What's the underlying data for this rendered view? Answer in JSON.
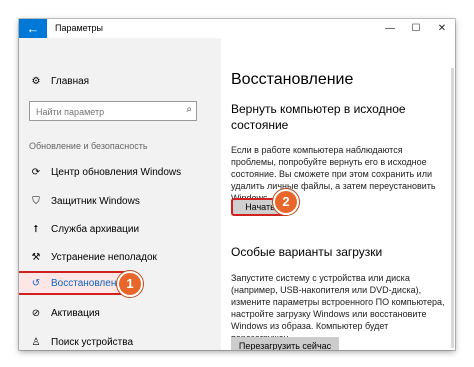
{
  "window": {
    "title": "Параметры",
    "back_icon": "←",
    "controls": {
      "minimize": "—",
      "maximize": "☐",
      "close": "✕"
    }
  },
  "sidebar": {
    "home": {
      "icon": "gear-icon",
      "glyph": "⚙",
      "label": "Главная"
    },
    "search": {
      "placeholder": "Найти параметр",
      "icon": "search-icon",
      "glyph": "⌕"
    },
    "section_title": "Обновление и безопасность",
    "items": [
      {
        "id": "update",
        "icon": "refresh-icon",
        "glyph": "⟳",
        "label": "Центр обновления Windows"
      },
      {
        "id": "defender",
        "icon": "shield-icon",
        "glyph": "⛉",
        "label": "Защитник Windows"
      },
      {
        "id": "backup",
        "icon": "backup-icon",
        "glyph": "⭡",
        "label": "Служба архивации"
      },
      {
        "id": "troubleshoot",
        "icon": "wrench-icon",
        "glyph": "⚒",
        "label": "Устранение неполадок"
      },
      {
        "id": "recovery",
        "icon": "history-icon",
        "glyph": "↺",
        "label": "Восстановление",
        "active": true
      },
      {
        "id": "activation",
        "icon": "check-circle-icon",
        "glyph": "⊘",
        "label": "Активация"
      },
      {
        "id": "find-device",
        "icon": "person-icon",
        "glyph": "♙",
        "label": "Поиск устройства"
      }
    ]
  },
  "main": {
    "page_title": "Восстановление",
    "reset": {
      "heading": "Вернуть компьютер в исходное состояние",
      "description": "Если в работе компьютера наблюдаются проблемы, попробуйте вернуть его в исходное состояние. Вы сможете при этом сохранить или удалить личные файлы, а затем переустановить Windows.",
      "button": "Начать"
    },
    "advanced": {
      "heading": "Особые варианты загрузки",
      "description": "Запустите систему с устройства или диска (например, USB-накопителя или DVD-диска), измените параметры встроенного ПО компьютера, настройте загрузку Windows или восстановите Windows из образа. Компьютер будет перезагружен.",
      "button": "Перезагрузить сейчас"
    }
  },
  "annotations": {
    "step1": "1",
    "step2": "2",
    "color": "#e8662a",
    "highlight_color": "#d02020"
  },
  "colors": {
    "accent": "#0078d7",
    "link": "#0b64c3"
  }
}
